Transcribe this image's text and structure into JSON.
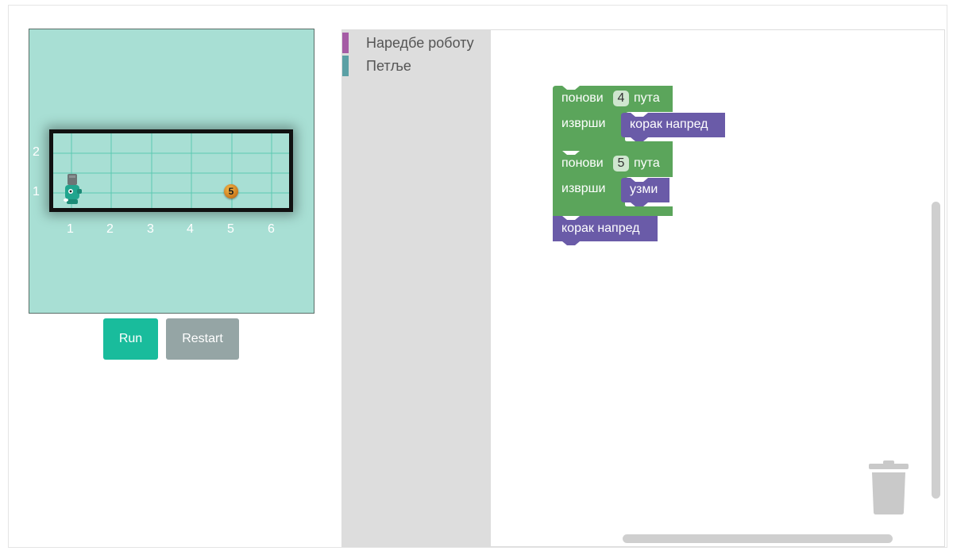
{
  "game": {
    "y_axis_labels": [
      "2",
      "1"
    ],
    "x_axis_labels": [
      "1",
      "2",
      "3",
      "4",
      "5",
      "6"
    ],
    "coin_value": "5",
    "colors": {
      "stage": "#a8dfd4",
      "grid_line": "#5bc9b2"
    }
  },
  "controls": {
    "run_label": "Run",
    "restart_label": "Restart",
    "run_color": "#19bc9c",
    "restart_color": "#95a5a5"
  },
  "toolbox": {
    "categories": [
      {
        "label": "Наредбе роботу",
        "color": "#a55ca5"
      },
      {
        "label": "Петље",
        "color": "#5ba0a5"
      }
    ]
  },
  "workspace": {
    "blocks": {
      "repeat1": {
        "repeat_label": "понови",
        "count": "4",
        "times_label": "пута",
        "do_label": "изврши",
        "inner": "корак напред"
      },
      "repeat2": {
        "repeat_label": "понови",
        "count": "5",
        "times_label": "пута",
        "do_label": "изврши",
        "inner": "узми"
      },
      "step": {
        "label": "корак напред"
      }
    },
    "colors": {
      "loop": "#5ba55b",
      "robot_command": "#6a5ba8"
    }
  },
  "icons": {
    "trash": "trash-can-icon",
    "robot": "robot-icon",
    "coin": "coin-icon"
  }
}
